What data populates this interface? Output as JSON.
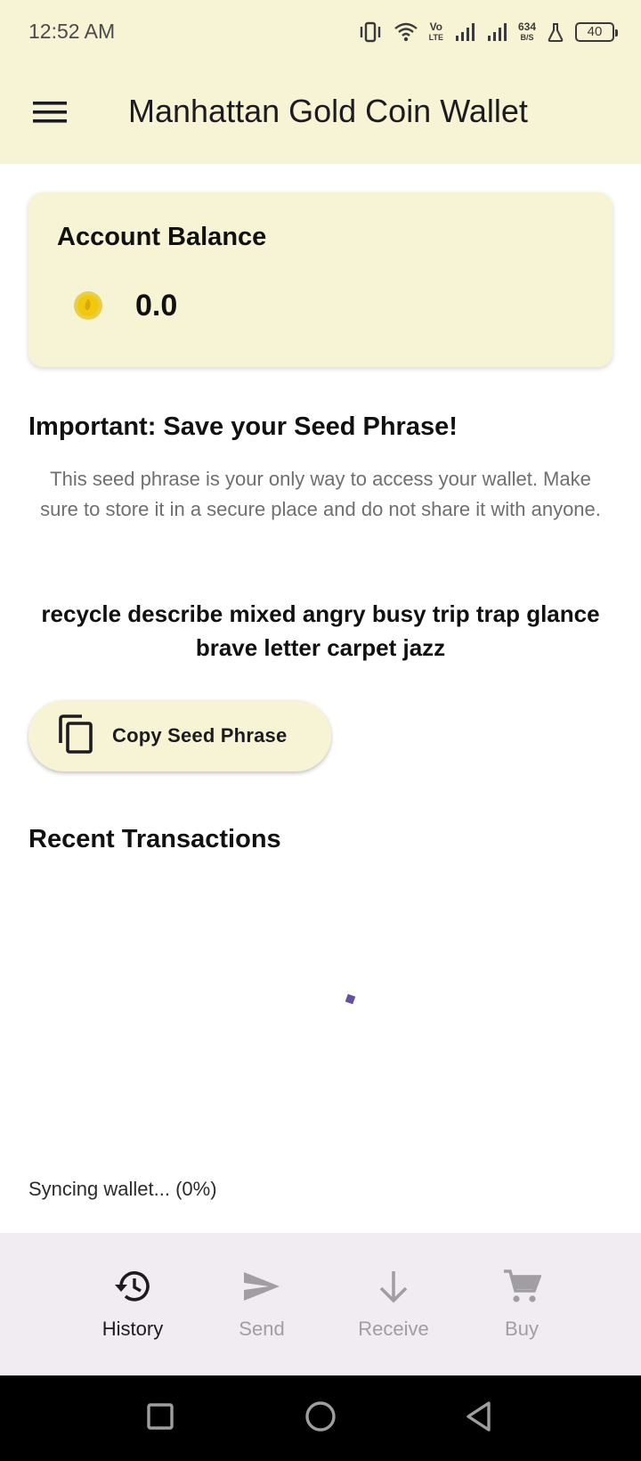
{
  "status_bar": {
    "time": "12:52 AM",
    "network_speed_value": "634",
    "network_speed_unit": "B/S",
    "volte_label": "Vo",
    "volte_sub": "LTE",
    "battery_level": "40"
  },
  "app_bar": {
    "title": "Manhattan Gold Coin Wallet",
    "menu_icon": "menu-icon"
  },
  "balance_card": {
    "label": "Account Balance",
    "value": "0.0",
    "coin_icon": "gold-coin-icon"
  },
  "seed_section": {
    "heading": "Important: Save your Seed Phrase!",
    "description": "This seed phrase is your only way to access your wallet. Make sure to store it in a secure place and do not share it with anyone.",
    "phrase": "recycle describe mixed angry busy trip trap glance brave letter carpet jazz",
    "copy_button_label": "Copy Seed Phrase",
    "copy_icon": "copy-icon"
  },
  "transactions": {
    "heading": "Recent Transactions",
    "sync_status": "Syncing wallet... (0%)"
  },
  "bottom_nav": {
    "items": [
      {
        "label": "History",
        "icon": "history-icon",
        "active": true
      },
      {
        "label": "Send",
        "icon": "send-icon",
        "active": false
      },
      {
        "label": "Receive",
        "icon": "arrow-down-icon",
        "active": false
      },
      {
        "label": "Buy",
        "icon": "cart-icon",
        "active": false
      }
    ]
  },
  "colors": {
    "surface_yellow": "#f7f4d5",
    "nav_background": "#f1ecf1",
    "active_nav": "#1c1b1f",
    "inactive_nav": "#a09ea2",
    "accent_purple": "#6750a4",
    "coin_gold": "#f2c80f"
  }
}
